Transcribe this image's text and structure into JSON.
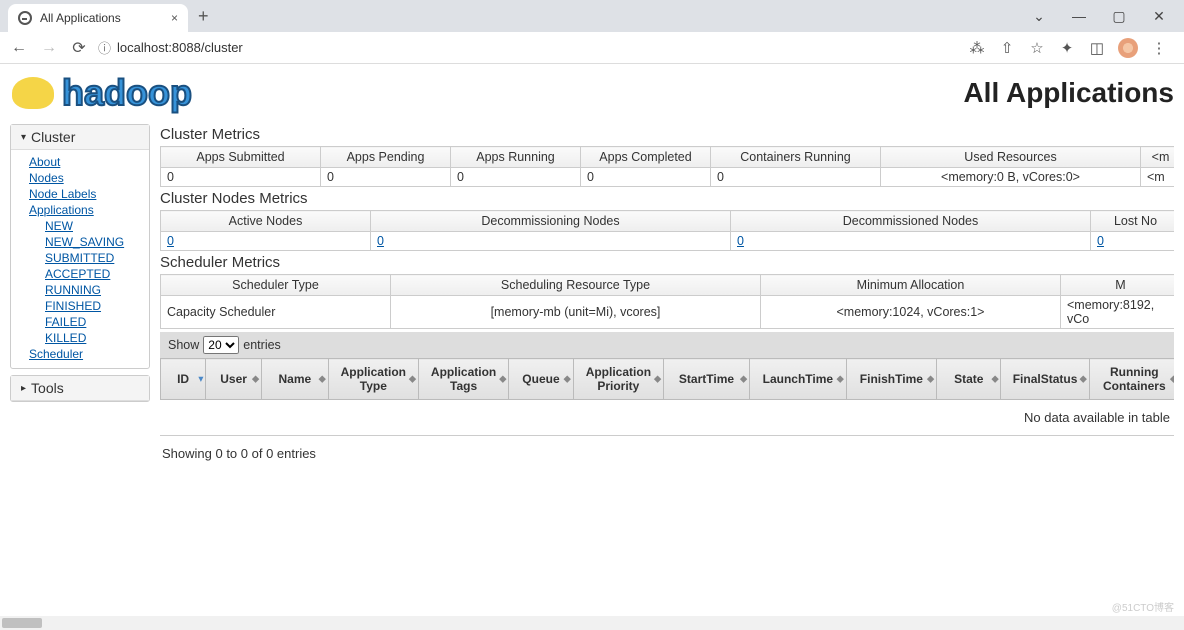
{
  "browser": {
    "tab_title": "All Applications",
    "url": "localhost:8088/cluster"
  },
  "page": {
    "logo_text": "hadoop",
    "title": "All Applications"
  },
  "sidebar": {
    "cluster_label": "Cluster",
    "tools_label": "Tools",
    "links": {
      "about": "About",
      "nodes": "Nodes",
      "node_labels": "Node Labels",
      "applications": "Applications",
      "scheduler": "Scheduler"
    },
    "app_states": {
      "new": "NEW",
      "new_saving": "NEW_SAVING",
      "submitted": "SUBMITTED",
      "accepted": "ACCEPTED",
      "running": "RUNNING",
      "finished": "FINISHED",
      "failed": "FAILED",
      "killed": "KILLED"
    }
  },
  "sections": {
    "cluster_metrics": "Cluster Metrics",
    "cluster_nodes_metrics": "Cluster Nodes Metrics",
    "scheduler_metrics": "Scheduler Metrics"
  },
  "cluster_metrics": {
    "headers": {
      "apps_submitted": "Apps Submitted",
      "apps_pending": "Apps Pending",
      "apps_running": "Apps Running",
      "apps_completed": "Apps Completed",
      "containers_running": "Containers Running",
      "used_resources": "Used Resources",
      "overflow": "<m"
    },
    "values": {
      "apps_submitted": "0",
      "apps_pending": "0",
      "apps_running": "0",
      "apps_completed": "0",
      "containers_running": "0",
      "used_resources": "<memory:0 B, vCores:0>",
      "overflow": "<m"
    }
  },
  "nodes_metrics": {
    "headers": {
      "active": "Active Nodes",
      "decommissioning": "Decommissioning Nodes",
      "decommissioned": "Decommissioned Nodes",
      "lost": "Lost No"
    },
    "values": {
      "active": "0",
      "decommissioning": "0",
      "decommissioned": "0",
      "lost": "0"
    }
  },
  "scheduler_metrics": {
    "headers": {
      "type": "Scheduler Type",
      "resource_type": "Scheduling Resource Type",
      "min_alloc": "Minimum Allocation",
      "max_alloc": "M"
    },
    "values": {
      "type": "Capacity Scheduler",
      "resource_type": "[memory-mb (unit=Mi), vcores]",
      "min_alloc": "<memory:1024, vCores:1>",
      "max_alloc": "<memory:8192, vCo"
    }
  },
  "datatable": {
    "show_prefix": "Show",
    "show_value": "20",
    "show_suffix": "entries",
    "columns": {
      "id": "ID",
      "user": "User",
      "name": "Name",
      "app_type": "Application Type",
      "app_tags": "Application Tags",
      "queue": "Queue",
      "app_priority": "Application Priority",
      "start_time": "StartTime",
      "launch_time": "LaunchTime",
      "finish_time": "FinishTime",
      "state": "State",
      "final_status": "FinalStatus",
      "running_containers": "Running Containers"
    },
    "no_data": "No data available in table",
    "showing": "Showing 0 to 0 of 0 entries"
  },
  "watermark": "@51CTO博客"
}
